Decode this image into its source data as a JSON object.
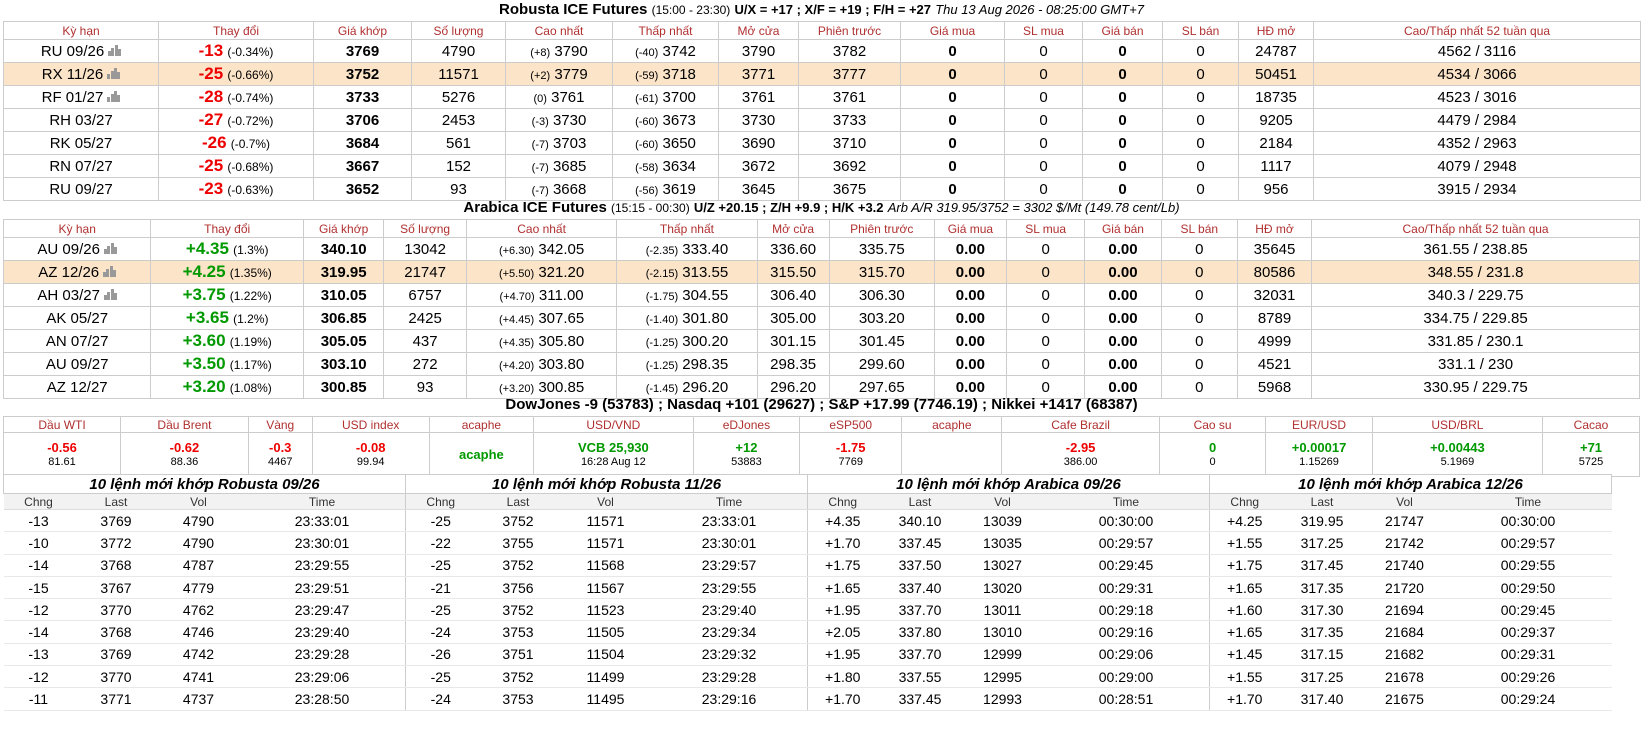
{
  "robusta": {
    "title_main": "Robusta ICE Futures",
    "title_hours": "(15:00 - 23:30)",
    "title_spreads": "U/X = +17 ; X/F = +19 ; F/H = +27",
    "title_time": "Thu 13 Aug 2026 - 08:25:00 GMT+7",
    "headers": [
      "Kỳ hạn",
      "Thay đổi",
      "Giá khớp",
      "Số lượng",
      "Cao nhất",
      "Thấp nhất",
      "Mở cửa",
      "Phiên trước",
      "Giá mua",
      "SL mua",
      "Giá bán",
      "SL bán",
      "HĐ mở",
      "Cao/Thấp nhất 52 tuần qua"
    ],
    "rows": [
      {
        "term": "RU 09/26",
        "chart": true,
        "chg": "-13",
        "pct": "(-0.34%)",
        "last": "3769",
        "vol": "4790",
        "hi_d": "(+8)",
        "hi": "3790",
        "lo_d": "(-40)",
        "lo": "3742",
        "open": "3790",
        "prev": "3782",
        "bid": "0",
        "bidq": "0",
        "ask": "0",
        "askq": "0",
        "oi": "24787",
        "hl52": "4562 / 3116"
      },
      {
        "term": "RX 11/26",
        "chart": true,
        "chg": "-25",
        "pct": "(-0.66%)",
        "last": "3752",
        "vol": "11571",
        "hi_d": "(+2)",
        "hi": "3779",
        "lo_d": "(-59)",
        "lo": "3718",
        "open": "3771",
        "prev": "3777",
        "bid": "0",
        "bidq": "0",
        "ask": "0",
        "askq": "0",
        "oi": "50451",
        "hl52": "4534 / 3066",
        "hl": true
      },
      {
        "term": "RF 01/27",
        "chart": true,
        "chg": "-28",
        "pct": "(-0.74%)",
        "last": "3733",
        "vol": "5276",
        "hi_d": "(0)",
        "hi": "3761",
        "lo_d": "(-61)",
        "lo": "3700",
        "open": "3761",
        "prev": "3761",
        "bid": "0",
        "bidq": "0",
        "ask": "0",
        "askq": "0",
        "oi": "18735",
        "hl52": "4523 / 3016"
      },
      {
        "term": "RH 03/27",
        "chart": false,
        "chg": "-27",
        "pct": "(-0.72%)",
        "last": "3706",
        "vol": "2453",
        "hi_d": "(-3)",
        "hi": "3730",
        "lo_d": "(-60)",
        "lo": "3673",
        "open": "3730",
        "prev": "3733",
        "bid": "0",
        "bidq": "0",
        "ask": "0",
        "askq": "0",
        "oi": "9205",
        "hl52": "4479 / 2984"
      },
      {
        "term": "RK 05/27",
        "chart": false,
        "chg": "-26",
        "pct": "(-0.7%)",
        "last": "3684",
        "vol": "561",
        "hi_d": "(-7)",
        "hi": "3703",
        "lo_d": "(-60)",
        "lo": "3650",
        "open": "3690",
        "prev": "3710",
        "bid": "0",
        "bidq": "0",
        "ask": "0",
        "askq": "0",
        "oi": "2184",
        "hl52": "4352 / 2963"
      },
      {
        "term": "RN 07/27",
        "chart": false,
        "chg": "-25",
        "pct": "(-0.68%)",
        "last": "3667",
        "vol": "152",
        "hi_d": "(-7)",
        "hi": "3685",
        "lo_d": "(-58)",
        "lo": "3634",
        "open": "3672",
        "prev": "3692",
        "bid": "0",
        "bidq": "0",
        "ask": "0",
        "askq": "0",
        "oi": "1117",
        "hl52": "4079 / 2948"
      },
      {
        "term": "RU 09/27",
        "chart": false,
        "chg": "-23",
        "pct": "(-0.63%)",
        "last": "3652",
        "vol": "93",
        "hi_d": "(-7)",
        "hi": "3668",
        "lo_d": "(-56)",
        "lo": "3619",
        "open": "3645",
        "prev": "3675",
        "bid": "0",
        "bidq": "0",
        "ask": "0",
        "askq": "0",
        "oi": "956",
        "hl52": "3915 / 2934"
      }
    ]
  },
  "arabica": {
    "title_main": "Arabica ICE Futures",
    "title_hours": "(15:15 - 00:30)",
    "title_spreads": "U/Z +20.15 ; Z/H +9.9 ; H/K +3.2",
    "title_arb": "Arb A/R 319.95/3752 = 3302 $/Mt (149.78 cent/Lb)",
    "headers": [
      "Kỳ hạn",
      "Thay đổi",
      "Giá khớp",
      "Số lượng",
      "Cao nhất",
      "Thấp nhất",
      "Mở cửa",
      "Phiên trước",
      "Giá mua",
      "SL mua",
      "Giá bán",
      "SL bán",
      "HĐ mở",
      "Cao/Thấp nhất 52 tuần qua"
    ],
    "rows": [
      {
        "term": "AU 09/26",
        "chart": true,
        "chg": "+4.35",
        "pct": "(1.3%)",
        "last": "340.10",
        "vol": "13042",
        "hi_d": "(+6.30)",
        "hi": "342.05",
        "lo_d": "(-2.35)",
        "lo": "333.40",
        "open": "336.60",
        "prev": "335.75",
        "bid": "0.00",
        "bidq": "0",
        "ask": "0.00",
        "askq": "0",
        "oi": "35645",
        "hl52": "361.55 / 238.85"
      },
      {
        "term": "AZ 12/26",
        "chart": true,
        "chg": "+4.25",
        "pct": "(1.35%)",
        "last": "319.95",
        "vol": "21747",
        "hi_d": "(+5.50)",
        "hi": "321.20",
        "lo_d": "(-2.15)",
        "lo": "313.55",
        "open": "315.50",
        "prev": "315.70",
        "bid": "0.00",
        "bidq": "0",
        "ask": "0.00",
        "askq": "0",
        "oi": "80586",
        "hl52": "348.55 / 231.8",
        "hl": true
      },
      {
        "term": "AH 03/27",
        "chart": true,
        "chg": "+3.75",
        "pct": "(1.22%)",
        "last": "310.05",
        "vol": "6757",
        "hi_d": "(+4.70)",
        "hi": "311.00",
        "lo_d": "(-1.75)",
        "lo": "304.55",
        "open": "306.40",
        "prev": "306.30",
        "bid": "0.00",
        "bidq": "0",
        "ask": "0.00",
        "askq": "0",
        "oi": "32031",
        "hl52": "340.3 / 229.75"
      },
      {
        "term": "AK 05/27",
        "chart": false,
        "chg": "+3.65",
        "pct": "(1.2%)",
        "last": "306.85",
        "vol": "2425",
        "hi_d": "(+4.45)",
        "hi": "307.65",
        "lo_d": "(-1.40)",
        "lo": "301.80",
        "open": "305.00",
        "prev": "303.20",
        "bid": "0.00",
        "bidq": "0",
        "ask": "0.00",
        "askq": "0",
        "oi": "8789",
        "hl52": "334.75 / 229.85"
      },
      {
        "term": "AN 07/27",
        "chart": false,
        "chg": "+3.60",
        "pct": "(1.19%)",
        "last": "305.05",
        "vol": "437",
        "hi_d": "(+4.35)",
        "hi": "305.80",
        "lo_d": "(-1.25)",
        "lo": "300.20",
        "open": "301.15",
        "prev": "301.45",
        "bid": "0.00",
        "bidq": "0",
        "ask": "0.00",
        "askq": "0",
        "oi": "4999",
        "hl52": "331.85 / 230.1"
      },
      {
        "term": "AU 09/27",
        "chart": false,
        "chg": "+3.50",
        "pct": "(1.17%)",
        "last": "303.10",
        "vol": "272",
        "hi_d": "(+4.20)",
        "hi": "303.80",
        "lo_d": "(-1.25)",
        "lo": "298.35",
        "open": "298.35",
        "prev": "299.60",
        "bid": "0.00",
        "bidq": "0",
        "ask": "0.00",
        "askq": "0",
        "oi": "4521",
        "hl52": "331.1 / 230"
      },
      {
        "term": "AZ 12/27",
        "chart": false,
        "chg": "+3.20",
        "pct": "(1.08%)",
        "last": "300.85",
        "vol": "93",
        "hi_d": "(+3.20)",
        "hi": "300.85",
        "lo_d": "(-1.45)",
        "lo": "296.20",
        "open": "296.20",
        "prev": "297.65",
        "bid": "0.00",
        "bidq": "0",
        "ask": "0.00",
        "askq": "0",
        "oi": "5968",
        "hl52": "330.95 / 229.75"
      }
    ]
  },
  "indices_title": "DowJones -9 (53783) ; Nasdaq +101 (29627) ; S&P +17.99 (7746.19) ; Nikkei +1417 (68387)",
  "markets": [
    {
      "label": "Dầu WTI",
      "value": "-0.56",
      "sub": "81.61",
      "color": "red"
    },
    {
      "label": "Dầu Brent",
      "value": "-0.62",
      "sub": "88.36",
      "color": "red"
    },
    {
      "label": "Vàng",
      "value": "-0.3",
      "sub": "4467",
      "color": "red"
    },
    {
      "label": "USD index",
      "value": "-0.08",
      "sub": "99.94",
      "color": "red"
    },
    {
      "label": "acaphe",
      "value": "acaphe",
      "sub": "",
      "color": "grn"
    },
    {
      "label": "USD/VND",
      "value": "VCB 25,930",
      "sub": "16:28 Aug 12",
      "color": "grn"
    },
    {
      "label": "eDJones",
      "value": "+12",
      "sub": "53883",
      "color": "grn"
    },
    {
      "label": "eSP500",
      "value": "-1.75",
      "sub": "7769",
      "color": "red"
    },
    {
      "label": "acaphe",
      "value": "",
      "sub": "",
      "color": "grn"
    },
    {
      "label": "Cafe Brazil",
      "value": "-2.95",
      "sub": "386.00",
      "color": "red"
    },
    {
      "label": "Cao su",
      "value": "0",
      "sub": "0",
      "color": "grn"
    },
    {
      "label": "EUR/USD",
      "value": "+0.00017",
      "sub": "1.15269",
      "color": "grn"
    },
    {
      "label": "USD/BRL",
      "value": "+0.00443",
      "sub": "5.1969",
      "color": "grn"
    },
    {
      "label": "Cacao",
      "value": "+71",
      "sub": "5725",
      "color": "grn"
    }
  ],
  "ticks_headers": [
    "Chng",
    "Last",
    "Vol",
    "Time"
  ],
  "ticks": [
    {
      "title": "10 lệnh mới khớp Robusta 09/26",
      "rows": [
        [
          "-13",
          "3769",
          "4790",
          "23:33:01"
        ],
        [
          "-10",
          "3772",
          "4790",
          "23:30:01"
        ],
        [
          "-14",
          "3768",
          "4787",
          "23:29:55"
        ],
        [
          "-15",
          "3767",
          "4779",
          "23:29:51"
        ],
        [
          "-12",
          "3770",
          "4762",
          "23:29:47"
        ],
        [
          "-14",
          "3768",
          "4746",
          "23:29:40"
        ],
        [
          "-13",
          "3769",
          "4742",
          "23:29:28"
        ],
        [
          "-12",
          "3770",
          "4741",
          "23:29:06"
        ],
        [
          "-11",
          "3771",
          "4737",
          "23:28:50"
        ]
      ]
    },
    {
      "title": "10 lệnh mới khớp Robusta 11/26",
      "rows": [
        [
          "-25",
          "3752",
          "11571",
          "23:33:01"
        ],
        [
          "-22",
          "3755",
          "11571",
          "23:30:01"
        ],
        [
          "-25",
          "3752",
          "11568",
          "23:29:57"
        ],
        [
          "-21",
          "3756",
          "11567",
          "23:29:55"
        ],
        [
          "-25",
          "3752",
          "11523",
          "23:29:40"
        ],
        [
          "-24",
          "3753",
          "11505",
          "23:29:34"
        ],
        [
          "-26",
          "3751",
          "11504",
          "23:29:32"
        ],
        [
          "-25",
          "3752",
          "11499",
          "23:29:28"
        ],
        [
          "-24",
          "3753",
          "11495",
          "23:29:16"
        ]
      ]
    },
    {
      "title": "10 lệnh mới khớp Arabica 09/26",
      "rows": [
        [
          "+4.35",
          "340.10",
          "13039",
          "00:30:00"
        ],
        [
          "+1.70",
          "337.45",
          "13035",
          "00:29:57"
        ],
        [
          "+1.75",
          "337.50",
          "13027",
          "00:29:45"
        ],
        [
          "+1.65",
          "337.40",
          "13020",
          "00:29:31"
        ],
        [
          "+1.95",
          "337.70",
          "13011",
          "00:29:18"
        ],
        [
          "+2.05",
          "337.80",
          "13010",
          "00:29:16"
        ],
        [
          "+1.95",
          "337.70",
          "12999",
          "00:29:06"
        ],
        [
          "+1.80",
          "337.55",
          "12995",
          "00:29:00"
        ],
        [
          "+1.70",
          "337.45",
          "12993",
          "00:28:51"
        ]
      ]
    },
    {
      "title": "10 lệnh mới khớp Arabica 12/26",
      "rows": [
        [
          "+4.25",
          "319.95",
          "21747",
          "00:30:00"
        ],
        [
          "+1.55",
          "317.25",
          "21742",
          "00:29:57"
        ],
        [
          "+1.75",
          "317.45",
          "21740",
          "00:29:55"
        ],
        [
          "+1.65",
          "317.35",
          "21720",
          "00:29:50"
        ],
        [
          "+1.60",
          "317.30",
          "21694",
          "00:29:45"
        ],
        [
          "+1.65",
          "317.35",
          "21684",
          "00:29:37"
        ],
        [
          "+1.45",
          "317.15",
          "21682",
          "00:29:31"
        ],
        [
          "+1.55",
          "317.25",
          "21678",
          "00:29:26"
        ],
        [
          "+1.70",
          "317.40",
          "21675",
          "00:29:24"
        ]
      ]
    }
  ]
}
